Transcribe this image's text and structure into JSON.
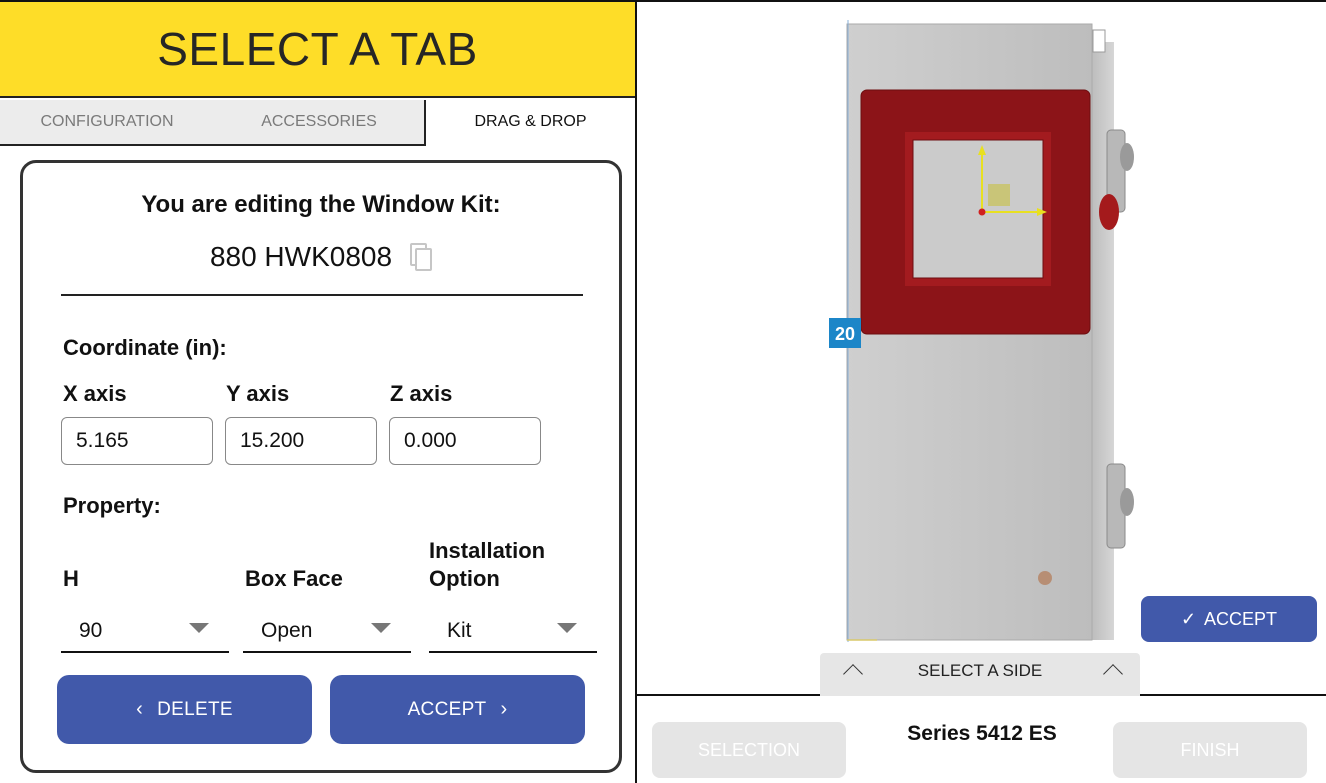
{
  "header": {
    "title": "SELECT A TAB"
  },
  "tabs": [
    {
      "label": "CONFIGURATION",
      "active": false
    },
    {
      "label": "ACCESSORIES",
      "active": false
    },
    {
      "label": "DRAG & DROP",
      "active": true
    }
  ],
  "editor": {
    "heading": "You are editing the Window Kit:",
    "part_number": "880 HWK0808",
    "coordinate_label": "Coordinate (in):",
    "axes": [
      {
        "label": "X axis",
        "value": "5.165"
      },
      {
        "label": "Y axis",
        "value": "15.200"
      },
      {
        "label": "Z axis",
        "value": "0.000"
      }
    ],
    "property_label": "Property:",
    "properties": [
      {
        "label": "H",
        "value": "90"
      },
      {
        "label": "Box Face",
        "value": "Open"
      },
      {
        "label": "Installation Option",
        "value": "Kit"
      }
    ],
    "delete_label": "DELETE",
    "accept_label": "ACCEPT"
  },
  "viewer": {
    "accept_label": "ACCEPT",
    "select_side_label": "SELECT A SIDE",
    "dimension_badge": "20"
  },
  "footer": {
    "selection_label": "SELECTION",
    "series_title": "Series 5412 ES",
    "finish_label": "FINISH"
  },
  "colors": {
    "accent_yellow": "#fedd28",
    "primary_blue": "#4159aa",
    "window_red": "#8c1418",
    "badge_blue": "#1c86c8"
  }
}
